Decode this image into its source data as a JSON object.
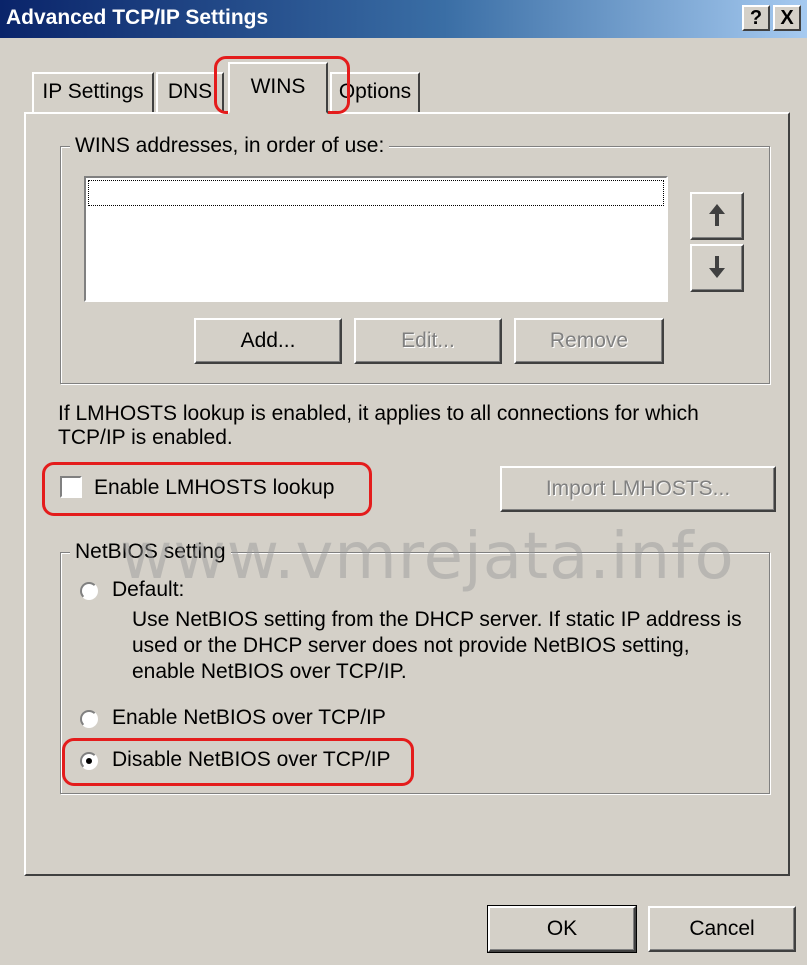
{
  "window": {
    "title": "Advanced TCP/IP Settings",
    "help_label": "?",
    "close_label": "X"
  },
  "tabs": [
    {
      "label": "IP Settings",
      "selected": false
    },
    {
      "label": "DNS",
      "selected": false
    },
    {
      "label": "WINS",
      "selected": true
    },
    {
      "label": "Options",
      "selected": false
    }
  ],
  "wins": {
    "group_label": "WINS addresses, in order of use:",
    "addresses": [],
    "move_up_icon": "up-arrow-icon",
    "move_down_icon": "down-arrow-icon",
    "add_label": "Add...",
    "edit_label": "Edit...",
    "remove_label": "Remove"
  },
  "lmhosts": {
    "info_line1": "If LMHOSTS lookup is enabled, it applies to all connections for which",
    "info_line2": "TCP/IP is enabled.",
    "enable_label": "Enable LMHOSTS lookup",
    "enable_checked": false,
    "import_label": "Import LMHOSTS..."
  },
  "netbios": {
    "group_label": "NetBIOS setting",
    "default_label": "Default:",
    "default_desc_line1": "Use NetBIOS setting from the DHCP server. If static IP address is",
    "default_desc_line2": "used or the DHCP server does not provide NetBIOS setting,",
    "default_desc_line3": "enable NetBIOS over TCP/IP.",
    "enable_label": "Enable NetBIOS over TCP/IP",
    "disable_label": "Disable NetBIOS over TCP/IP",
    "selected": "disable"
  },
  "footer": {
    "ok_label": "OK",
    "cancel_label": "Cancel"
  },
  "watermark": "www.vmrejata.info",
  "colors": {
    "highlight": "#e41c1c",
    "title_bar": "#0a246a",
    "dialog_face": "#d4d0c8"
  }
}
